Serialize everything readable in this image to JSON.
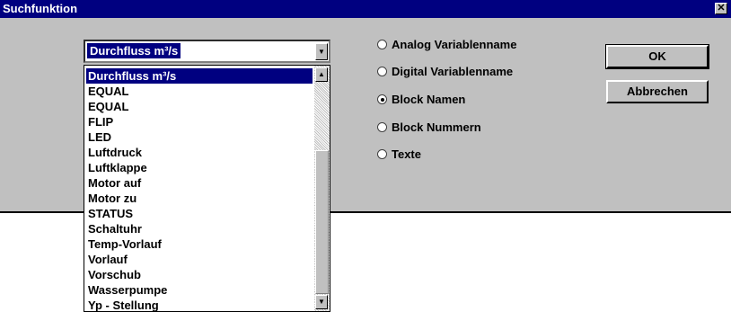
{
  "window": {
    "title": "Suchfunktion",
    "close_glyph": "✕"
  },
  "combo": {
    "value": "Durchfluss m³/s"
  },
  "list": {
    "items": [
      "Durchfluss m³/s",
      "EQUAL",
      "EQUAL",
      "FLIP",
      "LED",
      "Luftdruck",
      "Luftklappe",
      "Motor auf",
      "Motor zu",
      "STATUS",
      "Schaltuhr",
      "Temp-Vorlauf",
      "Vorlauf",
      "Vorschub",
      "Wasserpumpe",
      "Yp - Stellung"
    ],
    "selected_index": 0
  },
  "options": [
    {
      "label": "Analog Variablenname",
      "checked": false
    },
    {
      "label": "Digital Variablenname",
      "checked": false
    },
    {
      "label": "Block Namen",
      "checked": true
    },
    {
      "label": "Block Nummern",
      "checked": false
    },
    {
      "label": "Texte",
      "checked": false
    }
  ],
  "buttons": {
    "ok": "OK",
    "cancel": "Abbrechen"
  },
  "icons": {
    "close": "close-icon",
    "scroll_up": "arrow-up-icon",
    "scroll_down": "arrow-down-icon",
    "dropdown": "chevron-down-icon"
  },
  "colors": {
    "titlebar": "#000080",
    "face": "#c0c0c0",
    "selection": "#000080"
  }
}
